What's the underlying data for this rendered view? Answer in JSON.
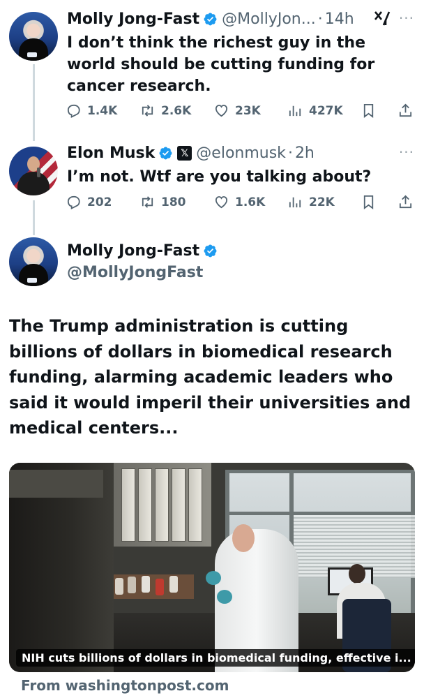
{
  "tweets": [
    {
      "name": "Molly Jong-Fast",
      "handle": "@MollyJon...",
      "time": "14h",
      "text": "I don’t think the richest guy in the world should be cutting funding for cancer research.",
      "stats": {
        "replies": "1.4K",
        "reposts": "2.6K",
        "likes": "23K",
        "views": "427K"
      }
    },
    {
      "name": "Elon Musk",
      "handle": "@elonmusk",
      "time": "2h",
      "text": "I’m not. Wtf are you talking about?",
      "stats": {
        "replies": "202",
        "reposts": "180",
        "likes": "1.6K",
        "views": "22K"
      }
    }
  ],
  "quoted": {
    "name": "Molly Jong-Fast",
    "handle": "@MollyJongFast",
    "text": "The Trump administration is cutting billions of dollars in biomedical research funding, alarming academic leaders who said it would imperil their universities and medical centers...",
    "card_caption": "NIH cuts billions of dollars in biomedical funding, effective i...",
    "source": "From washingtonpost.com"
  },
  "icons": {
    "more": "more-icon",
    "grok": "grok-icon",
    "verified": "verified-badge-icon",
    "x_affiliate": "x-affiliate-icon",
    "reply": "reply-icon",
    "repost": "repost-icon",
    "like": "like-icon",
    "views": "views-icon",
    "bookmark": "bookmark-icon",
    "share": "share-icon"
  },
  "colors": {
    "verified": "#1d9bf0",
    "muted": "#536471",
    "text": "#0f1419"
  },
  "glyphs": {
    "more": "···",
    "dot": "·",
    "x_badge": "𝕏"
  }
}
